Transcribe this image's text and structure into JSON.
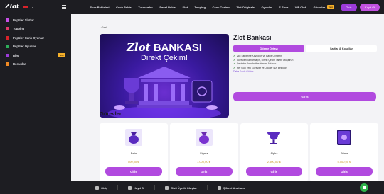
{
  "brand": {
    "logo": "Zlot"
  },
  "sidebar": {
    "items": [
      {
        "label": "Popüler Slotlar",
        "color": "#c94ee8"
      },
      {
        "label": "Yeni",
        "color": "#e33a6a",
        "tag": ""
      },
      {
        "label": "Topping",
        "color": "#e33a6a"
      },
      {
        "label": "Popüler Canlı Oyunlar",
        "color": "#d8232a"
      },
      {
        "label": "Popüler Oyunlar",
        "color": "#2eae5a"
      },
      {
        "label": "Bilet",
        "color": "#9c3bd9",
        "tag": "Yeni"
      },
      {
        "label": "Bonuslar",
        "color": "#f08a24"
      }
    ]
  },
  "topnav": {
    "links": [
      "Spor Bahisleri",
      "Canlı Bahis",
      "Turnuvalar",
      "Sanal Bahis",
      "Slot",
      "Topping",
      "Canlı Casino",
      "Zlot Originals",
      "Oyunlar",
      "E-Spor",
      "VIP Club",
      "Görevler"
    ],
    "new_badge": "Yeni",
    "login": "Giriş",
    "register": "Kayıt Ol"
  },
  "page": {
    "back": "‹ Geri",
    "hero": {
      "title_a": "Zlot",
      "title_b": "BANKASI",
      "subtitle": "Direkt Çekim!"
    },
    "title": "Zlot Bankası",
    "tabs": [
      "Ödeme Detayı",
      "Şartlar & Koşullar"
    ],
    "bullets": [
      "Zlot Sitelerine Kaydolun ve Bahis Oynayın",
      "Görevleri Tamamlayın, Direkt Çekim Talebi Oluşturun",
      "Çekimler Anında Hesabınıza Aktarılır",
      "Her Gün Yeni Görevler ve Ödüller Sizi Bekliyor"
    ],
    "more": "Daha Fazla Göster",
    "cta": "Giriş",
    "section": "Görevler",
    "cards": [
      {
        "name": "Beta",
        "price": "500,00 ₺",
        "button": "Giriş",
        "icon": "bag-icon"
      },
      {
        "name": "Sigma",
        "price": "1.000,00 ₺",
        "button": "Giriş",
        "icon": "bag-icon"
      },
      {
        "name": "Alpha",
        "price": "2.500,00 ₺",
        "button": "Giriş",
        "icon": "trophy-icon"
      },
      {
        "name": "Prime",
        "price": "5.000,00 ₺",
        "button": "Giriş",
        "icon": "card-icon"
      }
    ]
  },
  "bottombar": {
    "items": [
      "Giriş",
      "Kayıt Ol",
      "Gizli Üyelik Oluştur",
      "Şifreni Unuttum"
    ]
  },
  "colors": {
    "accent": "#b14adf",
    "dark": "#1d1d22"
  }
}
